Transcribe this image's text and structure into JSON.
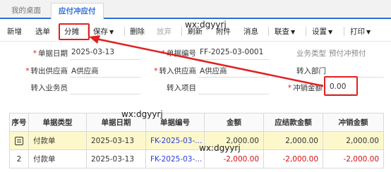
{
  "tabs": [
    {
      "label": "我的桌面"
    },
    {
      "label": "应付冲应付"
    }
  ],
  "toolbar": {
    "add": "新增",
    "select_source": "选单",
    "allocate": "分摊",
    "save": "保存",
    "delete": "删除",
    "discard": "放弃",
    "refresh": "刷新",
    "attachment": "附件",
    "message": "消息",
    "query": "联查",
    "settings": "设置",
    "print": "打印"
  },
  "form": {
    "doc_date_label": "单据日期",
    "doc_date": "2025-03-13",
    "doc_no_label": "单据编号",
    "doc_no": "FF-2025-03-0001",
    "biz_type_label": "业务类型",
    "biz_type": "预付冲预付",
    "out_supplier_label": "转出供应商",
    "out_supplier": "A供应商",
    "in_supplier_label": "转入供应商",
    "in_supplier": "A供应商",
    "in_dept_label": "转入部门",
    "in_dept": "",
    "in_salesman_label": "转入业务员",
    "in_salesman": "",
    "in_project_label": "转入项目",
    "in_project": "",
    "offset_amount_label": "冲销金额",
    "offset_amount": "0.00"
  },
  "table": {
    "headers": [
      "序号",
      "单据类型",
      "单据日期",
      "单据编号",
      "金额",
      "应结款金额",
      "冲销金额"
    ],
    "rows": [
      {
        "seq": "",
        "type": "付款单",
        "date": "2025-03-13",
        "no": "FK-2025-03-...",
        "amount": "2,000.00",
        "due": "2,000.00",
        "offset": "2,000.00"
      },
      {
        "seq": "2",
        "type": "付款单",
        "date": "2025-03-13",
        "no": "FK-2025-03-...",
        "amount": "-2,000.00",
        "due": "-2,000.00",
        "offset": "-2,000.00"
      }
    ]
  },
  "watermarks": [
    "wx:dgyyrj",
    "wx:dgyyrj",
    "wx:dgyyrj"
  ],
  "colors": {
    "accent": "#2f6fd6",
    "highlight": "#e02020",
    "selected_row": "#fdf8cc",
    "negative": "#d01010",
    "link": "#2a3fd4"
  }
}
